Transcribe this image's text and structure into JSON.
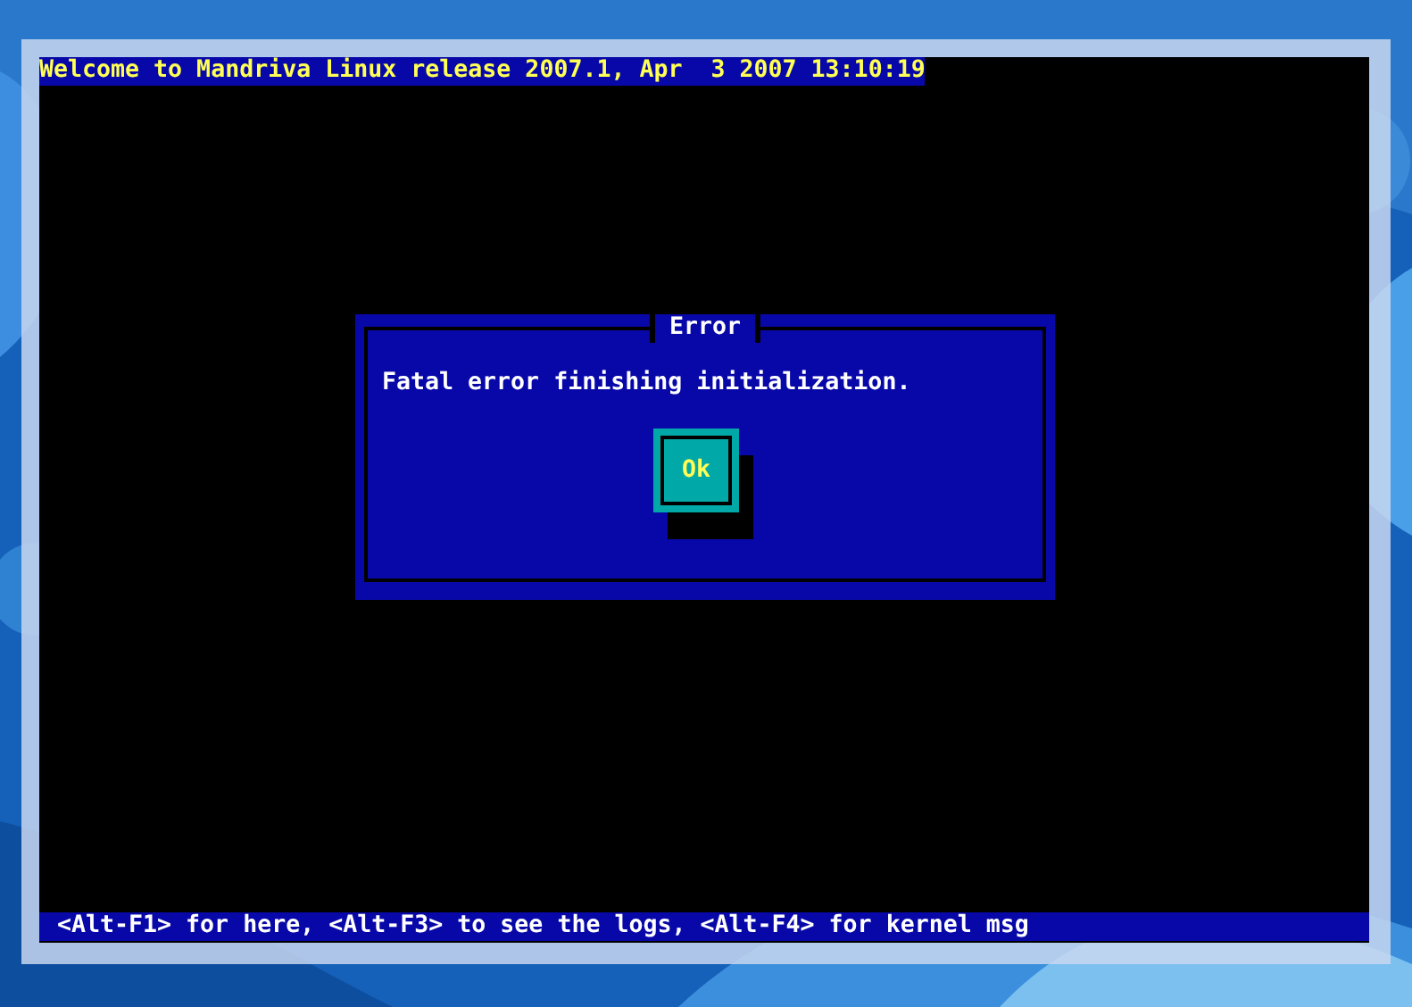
{
  "console": {
    "header": "Welcome to Mandriva Linux release 2007.1, Apr  3 2007 13:10:19",
    "dialog": {
      "title": "Error",
      "message": "Fatal error finishing initialization.",
      "buttons": [
        {
          "label": "Ok",
          "selected": true
        }
      ]
    },
    "footer": "<Alt-F1> for here, <Alt-F3> to see the logs, <Alt-F4> for kernel msg"
  }
}
